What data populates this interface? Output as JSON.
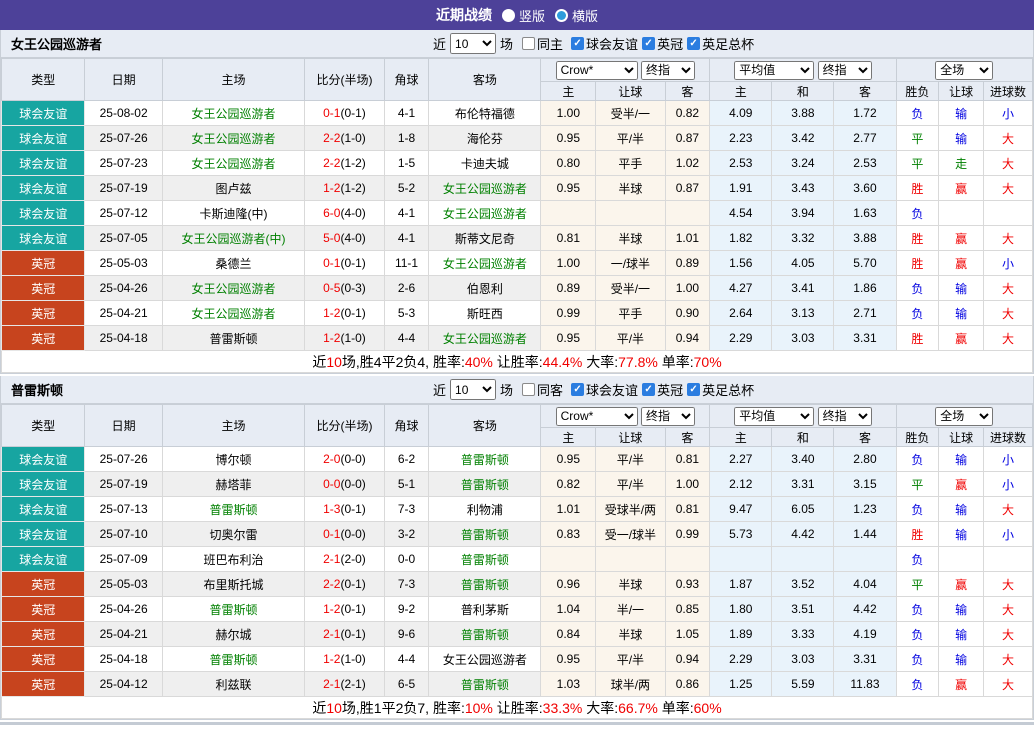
{
  "palette": {
    "purple": "#4D4199",
    "header_bg": "#E7ECF4",
    "alt_row": "#EFEFEF",
    "crow_col_bg": "#FBF5EC",
    "avg_col_bg": "#E9F3FB",
    "red": "#F00000",
    "green": "#008000",
    "blue": "#0000E0",
    "team_highlight_green": "#008000",
    "badge_friendly_teal": "#17A5A1",
    "badge_league_orange": "#C7441E",
    "radio_dot_blue": "#2D9CDB",
    "checkbox_blue": "#2B7DE0"
  },
  "titlebar": {
    "title": "近期战绩",
    "vertical_label": "竖版",
    "horizontal_label": "横版",
    "selected": "横版"
  },
  "filter_labels": {
    "near": "近",
    "matches": "场"
  },
  "table_header": {
    "cols": [
      "类型",
      "日期",
      "主场",
      "比分(半场)",
      "角球",
      "客场"
    ],
    "selects": [
      "Crow*",
      "终指",
      "平均值",
      "终指",
      "全场"
    ],
    "sub": [
      "主",
      "让球",
      "客",
      "主",
      "和",
      "客",
      "胜负",
      "让球",
      "进球数"
    ]
  },
  "badge_colors": {
    "球会友谊": "#17A5A1",
    "英冠": "#C7441E"
  },
  "result_colors": {
    "胜": "#F00000",
    "平": "#008000",
    "负": "#0000E0",
    "赢": "#F00000",
    "走": "#008000",
    "输": "#0000E0",
    "大": "#F00000",
    "小": "#0000E0"
  },
  "tables": [
    {
      "team": "女王公园巡游者",
      "filter": {
        "count": "10",
        "same_label": "同主",
        "same_checked": false,
        "leagues": [
          "球会友谊",
          "英冠",
          "英足总杯"
        ]
      },
      "rows": [
        {
          "league": "球会友谊",
          "date": "25-08-02",
          "home": "女王公园巡游者",
          "home_green": true,
          "score": "0-1",
          "half": "(0-1)",
          "corners": "4-1",
          "away": "布伦特福德",
          "away_green": false,
          "odds_home": "1.00",
          "odds_line": "受半/一",
          "odds_away": "0.82",
          "avg_home": "4.09",
          "avg_draw": "3.88",
          "avg_away": "1.72",
          "res_wdl": "负",
          "res_handicap": "输",
          "res_goals": "小"
        },
        {
          "league": "球会友谊",
          "date": "25-07-26",
          "home": "女王公园巡游者",
          "home_green": true,
          "score": "2-2",
          "half": "(1-0)",
          "corners": "1-8",
          "away": "海伦芬",
          "away_green": false,
          "odds_home": "0.95",
          "odds_line": "平/半",
          "odds_away": "0.87",
          "avg_home": "2.23",
          "avg_draw": "3.42",
          "avg_away": "2.77",
          "res_wdl": "平",
          "res_handicap": "输",
          "res_goals": "大"
        },
        {
          "league": "球会友谊",
          "date": "25-07-23",
          "home": "女王公园巡游者",
          "home_green": true,
          "score": "2-2",
          "half": "(1-2)",
          "corners": "1-5",
          "away": "卡迪夫城",
          "away_green": false,
          "odds_home": "0.80",
          "odds_line": "平手",
          "odds_away": "1.02",
          "avg_home": "2.53",
          "avg_draw": "3.24",
          "avg_away": "2.53",
          "res_wdl": "平",
          "res_handicap": "走",
          "res_goals": "大"
        },
        {
          "league": "球会友谊",
          "date": "25-07-19",
          "home": "图卢兹",
          "home_green": false,
          "score": "1-2",
          "half": "(1-2)",
          "corners": "5-2",
          "away": "女王公园巡游者",
          "away_green": true,
          "odds_home": "0.95",
          "odds_line": "半球",
          "odds_away": "0.87",
          "avg_home": "1.91",
          "avg_draw": "3.43",
          "avg_away": "3.60",
          "res_wdl": "胜",
          "res_handicap": "赢",
          "res_goals": "大"
        },
        {
          "league": "球会友谊",
          "date": "25-07-12",
          "home": "卡斯迪隆(中)",
          "home_green": false,
          "score": "6-0",
          "half": "(4-0)",
          "corners": "4-1",
          "away": "女王公园巡游者",
          "away_green": true,
          "odds_home": "",
          "odds_line": "",
          "odds_away": "",
          "avg_home": "4.54",
          "avg_draw": "3.94",
          "avg_away": "1.63",
          "res_wdl": "负",
          "res_handicap": "",
          "res_goals": ""
        },
        {
          "league": "球会友谊",
          "date": "25-07-05",
          "home": "女王公园巡游者(中)",
          "home_green": true,
          "score": "5-0",
          "half": "(4-0)",
          "corners": "4-1",
          "away": "斯蒂文尼奇",
          "away_green": false,
          "odds_home": "0.81",
          "odds_line": "半球",
          "odds_away": "1.01",
          "avg_home": "1.82",
          "avg_draw": "3.32",
          "avg_away": "3.88",
          "res_wdl": "胜",
          "res_handicap": "赢",
          "res_goals": "大"
        },
        {
          "league": "英冠",
          "date": "25-05-03",
          "home": "桑德兰",
          "home_green": false,
          "score": "0-1",
          "half": "(0-1)",
          "corners": "11-1",
          "away": "女王公园巡游者",
          "away_green": true,
          "odds_home": "1.00",
          "odds_line": "一/球半",
          "odds_away": "0.89",
          "avg_home": "1.56",
          "avg_draw": "4.05",
          "avg_away": "5.70",
          "res_wdl": "胜",
          "res_handicap": "赢",
          "res_goals": "小"
        },
        {
          "league": "英冠",
          "date": "25-04-26",
          "home": "女王公园巡游者",
          "home_green": true,
          "score": "0-5",
          "half": "(0-3)",
          "corners": "2-6",
          "away": "伯恩利",
          "away_green": false,
          "odds_home": "0.89",
          "odds_line": "受半/一",
          "odds_away": "1.00",
          "avg_home": "4.27",
          "avg_draw": "3.41",
          "avg_away": "1.86",
          "res_wdl": "负",
          "res_handicap": "输",
          "res_goals": "大"
        },
        {
          "league": "英冠",
          "date": "25-04-21",
          "home": "女王公园巡游者",
          "home_green": true,
          "score": "1-2",
          "half": "(0-1)",
          "corners": "5-3",
          "away": "斯旺西",
          "away_green": false,
          "odds_home": "0.99",
          "odds_line": "平手",
          "odds_away": "0.90",
          "avg_home": "2.64",
          "avg_draw": "3.13",
          "avg_away": "2.71",
          "res_wdl": "负",
          "res_handicap": "输",
          "res_goals": "大"
        },
        {
          "league": "英冠",
          "date": "25-04-18",
          "home": "普雷斯顿",
          "home_green": false,
          "score": "1-2",
          "half": "(1-0)",
          "corners": "4-4",
          "away": "女王公园巡游者",
          "away_green": true,
          "odds_home": "0.95",
          "odds_line": "平/半",
          "odds_away": "0.94",
          "avg_home": "2.29",
          "avg_draw": "3.03",
          "avg_away": "3.31",
          "res_wdl": "胜",
          "res_handicap": "赢",
          "res_goals": "大"
        }
      ],
      "summary": [
        {
          "text": "近",
          "red": false
        },
        {
          "text": "10",
          "red": true
        },
        {
          "text": "场,胜4平2负4, 胜率:",
          "red": false
        },
        {
          "text": "40%",
          "red": true
        },
        {
          "text": " 让胜率:",
          "red": false
        },
        {
          "text": "44.4%",
          "red": true
        },
        {
          "text": " 大率:",
          "red": false
        },
        {
          "text": "77.8%",
          "red": true
        },
        {
          "text": " 单率:",
          "red": false
        },
        {
          "text": "70%",
          "red": true
        }
      ]
    },
    {
      "team": "普雷斯顿",
      "filter": {
        "count": "10",
        "same_label": "同客",
        "same_checked": false,
        "leagues": [
          "球会友谊",
          "英冠",
          "英足总杯"
        ]
      },
      "rows": [
        {
          "league": "球会友谊",
          "date": "25-07-26",
          "home": "博尔顿",
          "home_green": false,
          "score": "2-0",
          "half": "(0-0)",
          "corners": "6-2",
          "away": "普雷斯顿",
          "away_green": true,
          "odds_home": "0.95",
          "odds_line": "平/半",
          "odds_away": "0.81",
          "avg_home": "2.27",
          "avg_draw": "3.40",
          "avg_away": "2.80",
          "res_wdl": "负",
          "res_handicap": "输",
          "res_goals": "小"
        },
        {
          "league": "球会友谊",
          "date": "25-07-19",
          "home": "赫塔菲",
          "home_green": false,
          "score": "0-0",
          "half": "(0-0)",
          "corners": "5-1",
          "away": "普雷斯顿",
          "away_green": true,
          "odds_home": "0.82",
          "odds_line": "平/半",
          "odds_away": "1.00",
          "avg_home": "2.12",
          "avg_draw": "3.31",
          "avg_away": "3.15",
          "res_wdl": "平",
          "res_handicap": "赢",
          "res_goals": "小"
        },
        {
          "league": "球会友谊",
          "date": "25-07-13",
          "home": "普雷斯顿",
          "home_green": true,
          "score": "1-3",
          "half": "(0-1)",
          "corners": "7-3",
          "away": "利物浦",
          "away_green": false,
          "odds_home": "1.01",
          "odds_line": "受球半/两",
          "odds_away": "0.81",
          "avg_home": "9.47",
          "avg_draw": "6.05",
          "avg_away": "1.23",
          "res_wdl": "负",
          "res_handicap": "输",
          "res_goals": "大"
        },
        {
          "league": "球会友谊",
          "date": "25-07-10",
          "home": "切奥尔雷",
          "home_green": false,
          "score": "0-1",
          "half": "(0-0)",
          "corners": "3-2",
          "away": "普雷斯顿",
          "away_green": true,
          "odds_home": "0.83",
          "odds_line": "受一/球半",
          "odds_away": "0.99",
          "avg_home": "5.73",
          "avg_draw": "4.42",
          "avg_away": "1.44",
          "res_wdl": "胜",
          "res_handicap": "输",
          "res_goals": "小"
        },
        {
          "league": "球会友谊",
          "date": "25-07-09",
          "home": "班巴布利治",
          "home_green": false,
          "score": "2-1",
          "half": "(2-0)",
          "corners": "0-0",
          "away": "普雷斯顿",
          "away_green": true,
          "odds_home": "",
          "odds_line": "",
          "odds_away": "",
          "avg_home": "",
          "avg_draw": "",
          "avg_away": "",
          "res_wdl": "负",
          "res_handicap": "",
          "res_goals": ""
        },
        {
          "league": "英冠",
          "date": "25-05-03",
          "home": "布里斯托城",
          "home_green": false,
          "score": "2-2",
          "half": "(0-1)",
          "corners": "7-3",
          "away": "普雷斯顿",
          "away_green": true,
          "odds_home": "0.96",
          "odds_line": "半球",
          "odds_away": "0.93",
          "avg_home": "1.87",
          "avg_draw": "3.52",
          "avg_away": "4.04",
          "res_wdl": "平",
          "res_handicap": "赢",
          "res_goals": "大"
        },
        {
          "league": "英冠",
          "date": "25-04-26",
          "home": "普雷斯顿",
          "home_green": true,
          "score": "1-2",
          "half": "(0-1)",
          "corners": "9-2",
          "away": "普利茅斯",
          "away_green": false,
          "odds_home": "1.04",
          "odds_line": "半/一",
          "odds_away": "0.85",
          "avg_home": "1.80",
          "avg_draw": "3.51",
          "avg_away": "4.42",
          "res_wdl": "负",
          "res_handicap": "输",
          "res_goals": "大"
        },
        {
          "league": "英冠",
          "date": "25-04-21",
          "home": "赫尔城",
          "home_green": false,
          "score": "2-1",
          "half": "(0-1)",
          "corners": "9-6",
          "away": "普雷斯顿",
          "away_green": true,
          "odds_home": "0.84",
          "odds_line": "半球",
          "odds_away": "1.05",
          "avg_home": "1.89",
          "avg_draw": "3.33",
          "avg_away": "4.19",
          "res_wdl": "负",
          "res_handicap": "输",
          "res_goals": "大"
        },
        {
          "league": "英冠",
          "date": "25-04-18",
          "home": "普雷斯顿",
          "home_green": true,
          "score": "1-2",
          "half": "(1-0)",
          "corners": "4-4",
          "away": "女王公园巡游者",
          "away_green": false,
          "odds_home": "0.95",
          "odds_line": "平/半",
          "odds_away": "0.94",
          "avg_home": "2.29",
          "avg_draw": "3.03",
          "avg_away": "3.31",
          "res_wdl": "负",
          "res_handicap": "输",
          "res_goals": "大"
        },
        {
          "league": "英冠",
          "date": "25-04-12",
          "home": "利兹联",
          "home_green": false,
          "score": "2-1",
          "half": "(2-1)",
          "corners": "6-5",
          "away": "普雷斯顿",
          "away_green": true,
          "odds_home": "1.03",
          "odds_line": "球半/两",
          "odds_away": "0.86",
          "avg_home": "1.25",
          "avg_draw": "5.59",
          "avg_away": "11.83",
          "res_wdl": "负",
          "res_handicap": "赢",
          "res_goals": "大"
        }
      ],
      "summary": [
        {
          "text": "近",
          "red": false
        },
        {
          "text": "10",
          "red": true
        },
        {
          "text": "场,胜1平2负7, 胜率:",
          "red": false
        },
        {
          "text": "10%",
          "red": true
        },
        {
          "text": " 让胜率:",
          "red": false
        },
        {
          "text": "33.3%",
          "red": true
        },
        {
          "text": " 大率:",
          "red": false
        },
        {
          "text": "66.7%",
          "red": true
        },
        {
          "text": " 单率:",
          "red": false
        },
        {
          "text": "60%",
          "red": true
        }
      ]
    }
  ]
}
